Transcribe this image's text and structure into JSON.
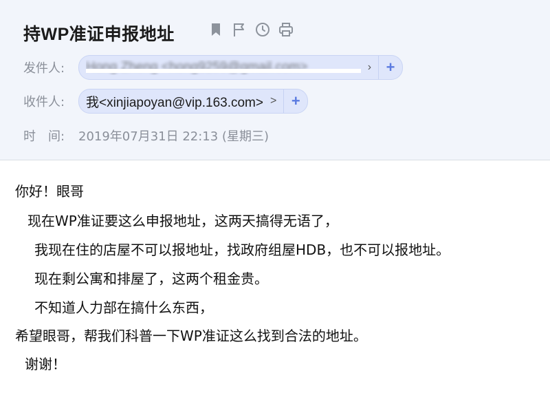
{
  "email": {
    "subject": "持WP准证申报地址",
    "toolbar_icons": [
      "bookmark-icon",
      "flag-icon",
      "clock-icon",
      "print-icon"
    ],
    "sender": {
      "label": "发件人:",
      "value": "Hong Zheng <hong9259@gmail.com>",
      "add_symbol": "+"
    },
    "recipient": {
      "label": "收件人:",
      "value": "我<xinjiapoyan@vip.163.com>",
      "chevron": ">",
      "add_symbol": "+"
    },
    "time": {
      "label": "时　间:",
      "value": "2019年07月31日 22:13 (星期三)"
    },
    "body_lines": [
      "你好！眼哥",
      "现在WP准证要这么申报地址，这两天搞得无语了，",
      "我现在住的店屋不可以报地址，找政府组屋HDB，也不可以报地址。",
      "现在剩公寓和排屋了，这两个租金贵。",
      "不知道人力部在搞什么东西，",
      "希望眼哥，帮我们科普一下WP准证这么找到合法的地址。",
      "谢谢！"
    ]
  },
  "colors": {
    "header_bg": "#f2f5fb",
    "chip_bg": "#dfe6fb",
    "accent": "#5b7be0",
    "label_gray": "#8a8f99"
  }
}
